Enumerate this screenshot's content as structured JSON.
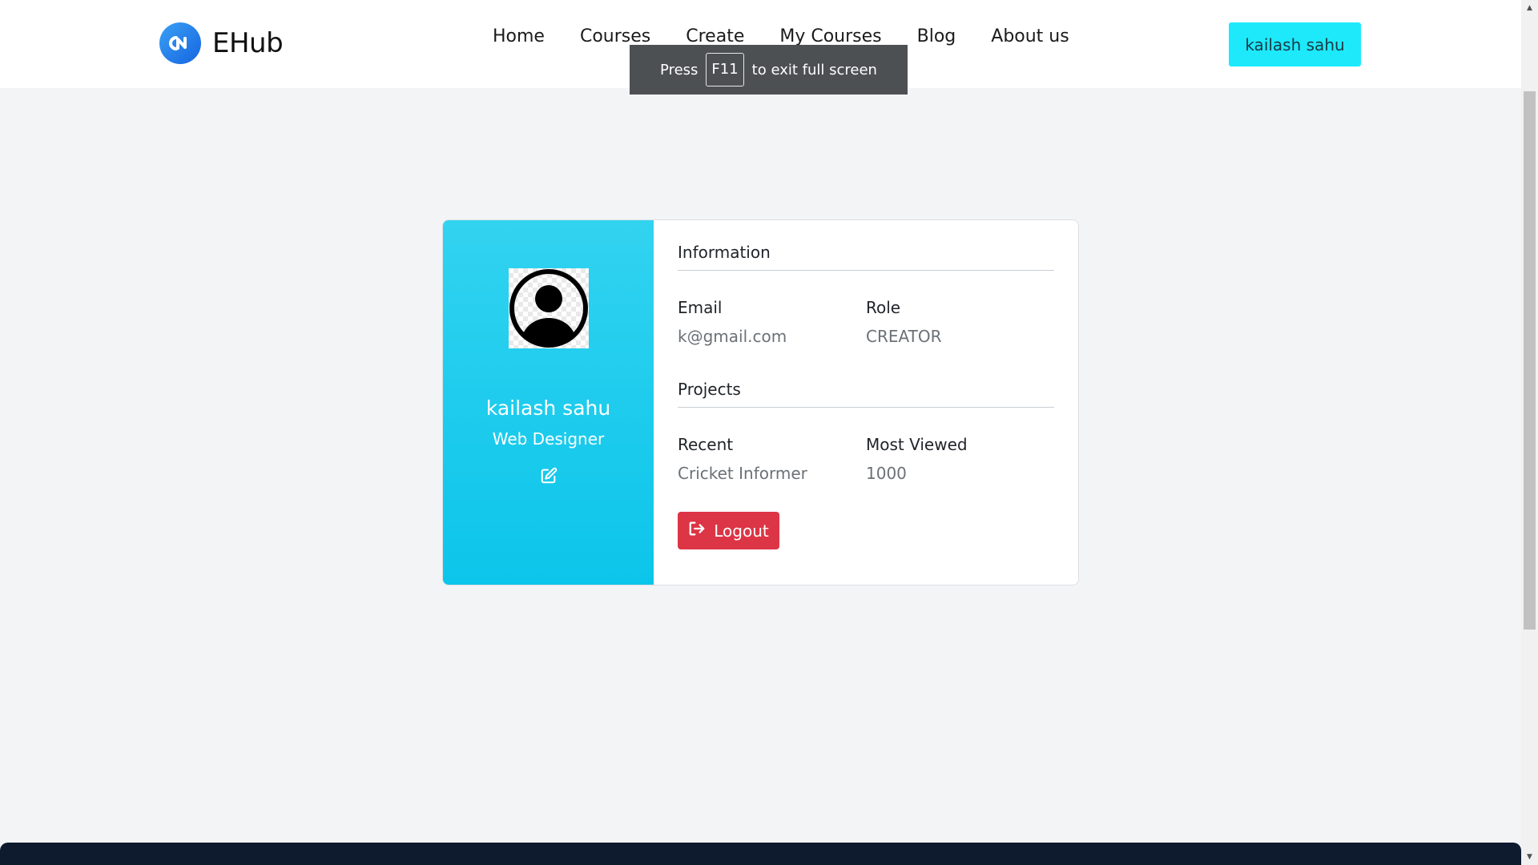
{
  "brand": {
    "name": "EHub",
    "logo_icon": "ehub-logo-icon",
    "logo_color": "#1e88e5"
  },
  "nav": {
    "items": [
      {
        "label": "Home"
      },
      {
        "label": "Courses"
      },
      {
        "label": "Create"
      },
      {
        "label": "My Courses"
      },
      {
        "label": "Blog"
      },
      {
        "label": "About us"
      }
    ],
    "user_button": "kailash sahu",
    "user_button_color": "#1de9fb"
  },
  "fullscreen_toast": {
    "press": "Press",
    "key": "F11",
    "suffix": "to exit full screen"
  },
  "profile": {
    "name": "kailash sahu",
    "title": "Web Designer",
    "avatar_icon": "user-avatar-icon",
    "edit_icon": "edit-icon",
    "panel_color": "#13c8ec"
  },
  "information": {
    "heading": "Information",
    "email_label": "Email",
    "email_value": "k@gmail.com",
    "role_label": "Role",
    "role_value": "CREATOR"
  },
  "projects": {
    "heading": "Projects",
    "recent_label": "Recent",
    "recent_value": "Cricket Informer",
    "most_viewed_label": "Most Viewed",
    "most_viewed_value": "1000"
  },
  "logout": {
    "label": "Logout",
    "icon": "logout-icon",
    "color": "#dc3545"
  }
}
